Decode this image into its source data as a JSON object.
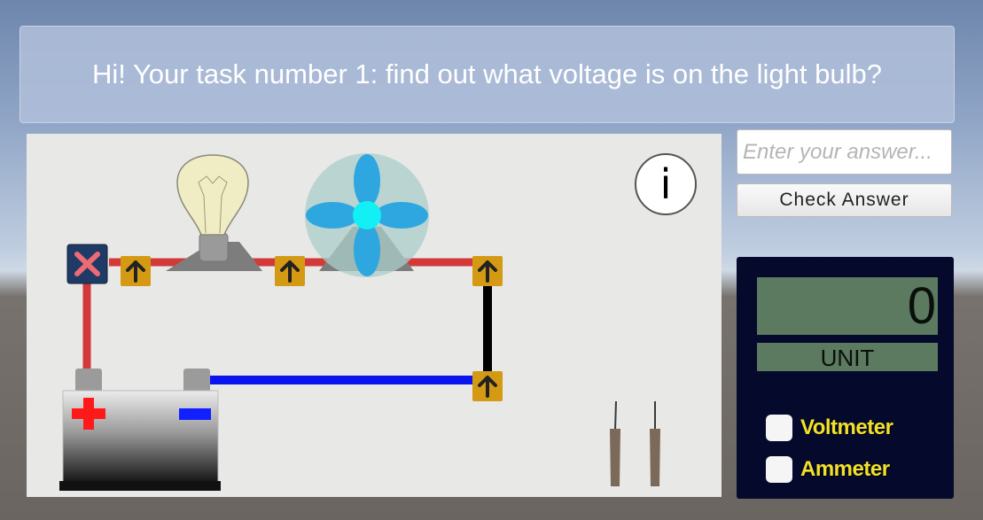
{
  "banner": {
    "text": "Hi! Your task number 1: find out what voltage is on the light bulb?"
  },
  "answer": {
    "placeholder": "Enter your answer...",
    "check_label": "Check Answer"
  },
  "info": {
    "label": "i"
  },
  "multimeter": {
    "display_value": "0",
    "unit_label": "UNIT",
    "modes": [
      {
        "label": "Voltmeter",
        "checked": false
      },
      {
        "label": "Ammeter",
        "checked": false
      }
    ]
  },
  "circuit": {
    "components": [
      "light-bulb",
      "fan",
      "battery",
      "switch",
      "test-probes"
    ],
    "wire_colors": {
      "positive": "#d23a3a",
      "negative": "#0a14ee",
      "segment": "#000000"
    },
    "battery_symbols": {
      "plus_color": "#ff1a1a",
      "minus_color": "#1020ff"
    },
    "node_color": "#d49a14"
  },
  "icons": {
    "switch": "close-x-icon",
    "node": "up-arrow-icon",
    "info": "info-icon"
  }
}
